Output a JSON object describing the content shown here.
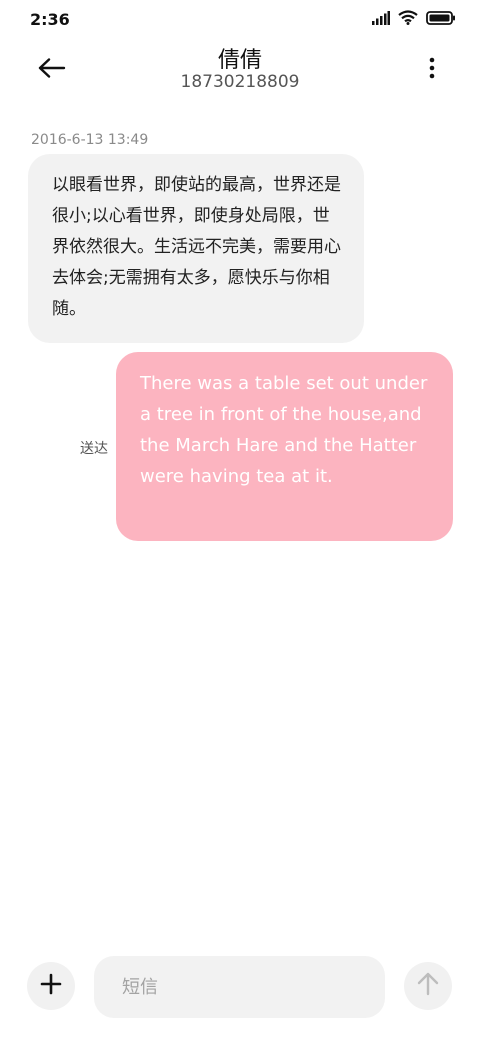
{
  "status_bar": {
    "time": "2:36",
    "icons": [
      "signal-icon",
      "wifi-icon",
      "battery-icon"
    ]
  },
  "header": {
    "contact_name": "倩倩",
    "contact_number": "18730218809",
    "icons": [
      "back-arrow-icon",
      "more-vertical-icon"
    ]
  },
  "conversation": {
    "timestamp": "2016-6-13 13:49",
    "messages": [
      {
        "direction": "received",
        "text": "以眼看世界，即使站的最高，世界还是很小;以心看世界，即使身处局限，世界依然很大。生活远不完美，需要用心去体会;无需拥有太多，愿快乐与你相随。"
      },
      {
        "direction": "sent",
        "text": "There was a table set out under a tree in front of the house,and the March Hare and the Hatter were having tea at it.",
        "status": "送达"
      }
    ]
  },
  "composer": {
    "placeholder": "短信",
    "value": "",
    "icons": [
      "plus-icon",
      "send-arrow-icon"
    ]
  },
  "colors": {
    "sent_bubble": "#fcb4c0",
    "received_bubble": "#f2f2f2",
    "background": "#ffffff"
  }
}
